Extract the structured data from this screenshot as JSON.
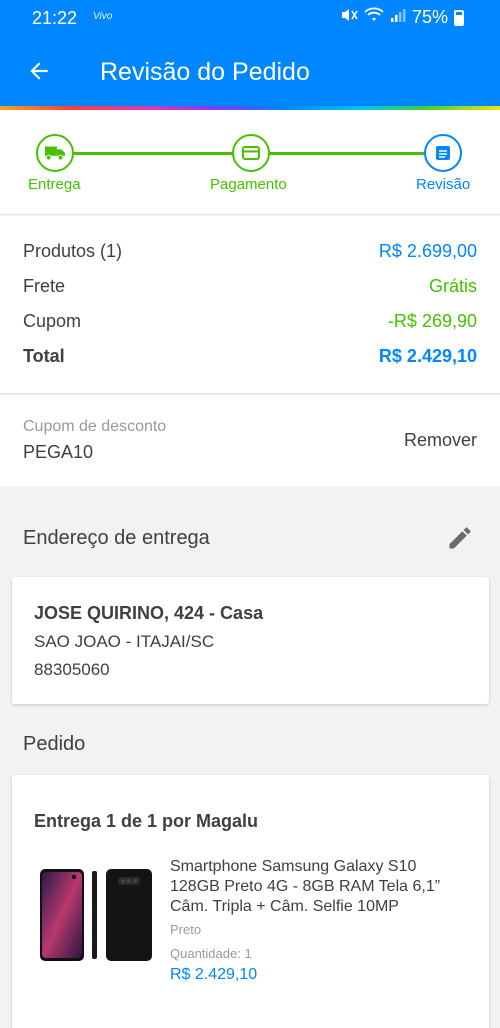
{
  "status_bar": {
    "time": "21:22",
    "carrier": "Vivo",
    "battery": "75%"
  },
  "header": {
    "title": "Revisão do Pedido"
  },
  "steps": [
    {
      "label": "Entrega"
    },
    {
      "label": "Pagamento"
    },
    {
      "label": "Revisão"
    }
  ],
  "summary": {
    "products_label": "Produtos (1)",
    "products_value": "R$ 2.699,00",
    "shipping_label": "Frete",
    "shipping_value": "Grátis",
    "coupon_label": "Cupom",
    "coupon_value": "-R$ 269,90",
    "total_label": "Total",
    "total_value": "R$ 2.429,10"
  },
  "coupon": {
    "label": "Cupom de desconto",
    "code": "PEGA10",
    "remove_label": "Remover"
  },
  "address": {
    "section_title": "Endereço de entrega",
    "line1": "JOSE QUIRINO, 424 - Casa",
    "line2": "SAO JOAO - ITAJAI/SC",
    "line3": "88305060"
  },
  "order": {
    "section_title": "Pedido",
    "delivery_heading": "Entrega 1 de 1 por Magalu",
    "product": {
      "name": "Smartphone Samsung Galaxy S10 128GB Preto 4G - 8GB RAM Tela 6,1” Câm. Tripla + Câm. Selfie 10MP",
      "color": "Preto",
      "quantity": "Quantidade:  1",
      "price": "R$ 2.429,10"
    }
  },
  "colors": {
    "primary": "#0086ff",
    "success": "#46c000",
    "text": "#404040",
    "muted": "#999999"
  }
}
